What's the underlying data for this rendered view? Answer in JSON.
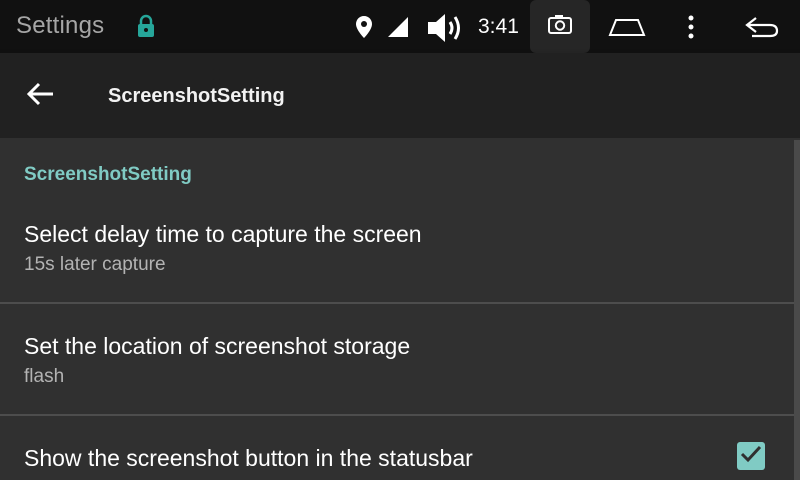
{
  "status_bar": {
    "app_title": "Settings",
    "time": "3:41",
    "icons": [
      "lock-icon",
      "location-icon",
      "signal-icon",
      "volume-icon",
      "camera-icon",
      "home-icon",
      "more-icon",
      "back-nav-icon"
    ],
    "accent_color": "#26a69a"
  },
  "toolbar": {
    "title": "ScreenshotSetting"
  },
  "settings": {
    "category": "ScreenshotSetting",
    "items": [
      {
        "title": "Select delay time to capture the screen",
        "summary": "15s later capture"
      },
      {
        "title": "Set the location of screenshot storage",
        "summary": "flash"
      },
      {
        "title": "Show the screenshot button in the statusbar",
        "checked": true
      }
    ],
    "accent_color": "#80cbc4"
  }
}
